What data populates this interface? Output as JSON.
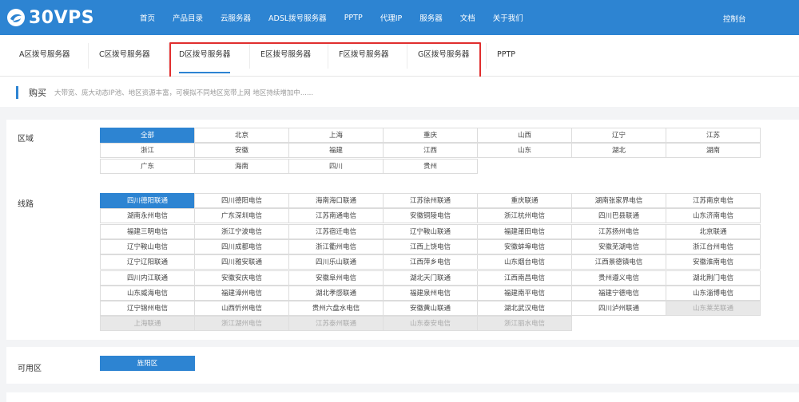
{
  "brand": {
    "name": "30VPS"
  },
  "nav": {
    "items": [
      "首页",
      "产品目录",
      "云服务器",
      "ADSL拨号服务器",
      "PPTP",
      "代理IP",
      "服务器",
      "文档",
      "关于我们"
    ],
    "console": "控制台"
  },
  "tabs": {
    "items": [
      "A区拨号服务器",
      "C区拨号服务器",
      "D区拨号服务器",
      "E区拨号服务器",
      "F区拨号服务器",
      "G区拨号服务器",
      "PPTP"
    ],
    "active_index": 2
  },
  "buy": {
    "title": "购买",
    "desc": "大带宽、庞大动态IP池、地区资源丰富，可模拟不同地区宽带上网 地区持续增加中......"
  },
  "region": {
    "label": "区域",
    "items": [
      "全部",
      "北京",
      "上海",
      "重庆",
      "山西",
      "辽宁",
      "江苏",
      "浙江",
      "安徽",
      "福建",
      "江西",
      "山东",
      "湖北",
      "湖南",
      "广东",
      "海南",
      "四川",
      "贵州"
    ],
    "selected": "全部"
  },
  "line": {
    "label": "线路",
    "items": [
      "四川德阳联通",
      "四川德阳电信",
      "海南海口联通",
      "江苏徐州联通",
      "重庆联通",
      "湖南张家界电信",
      "江苏南京电信",
      "湖南永州电信",
      "广东深圳电信",
      "江苏南通电信",
      "安徽铜陵电信",
      "浙江杭州电信",
      "四川巴县联通",
      "山东济南电信",
      "福建三明电信",
      "浙江宁波电信",
      "江苏宿迁电信",
      "辽宁鞍山联通",
      "福建莆田电信",
      "江苏扬州电信",
      "北京联通",
      "辽宁鞍山电信",
      "四川成都电信",
      "浙江衢州电信",
      "江西上饶电信",
      "安徽蚌埠电信",
      "安徽芜湖电信",
      "浙江台州电信",
      "辽宁辽阳联通",
      "四川雅安联通",
      "四川乐山联通",
      "江西萍乡电信",
      "山东烟台电信",
      "江西景德镇电信",
      "安徽淮南电信",
      "四川内江联通",
      "安徽安庆电信",
      "安徽阜州电信",
      "湖北天门联通",
      "江西南昌电信",
      "贵州遵义电信",
      "湖北荆门电信",
      "山东威海电信",
      "福建漳州电信",
      "湖北孝感联通",
      "福建泉州电信",
      "福建南平电信",
      "福建宁德电信",
      "山东淄博电信",
      "辽宁锦州电信",
      "山西忻州电信",
      "贵州六盘水电信",
      "安徽黄山联通",
      "湖北武汉电信",
      "四川泸州联通",
      "山东莱芜联通",
      "上海联通",
      "浙江湖州电信",
      "江苏泰州联通",
      "山东泰安电信",
      "浙江丽水电信"
    ],
    "selected": "四川德阳联通",
    "disabled": [
      "山东莱芜联通",
      "上海联通",
      "浙江湖州电信",
      "江苏泰州联通",
      "山东泰安电信",
      "浙江丽水电信"
    ]
  },
  "zone": {
    "label": "可用区",
    "items": [
      "旌阳区"
    ],
    "selected": "旌阳区"
  }
}
